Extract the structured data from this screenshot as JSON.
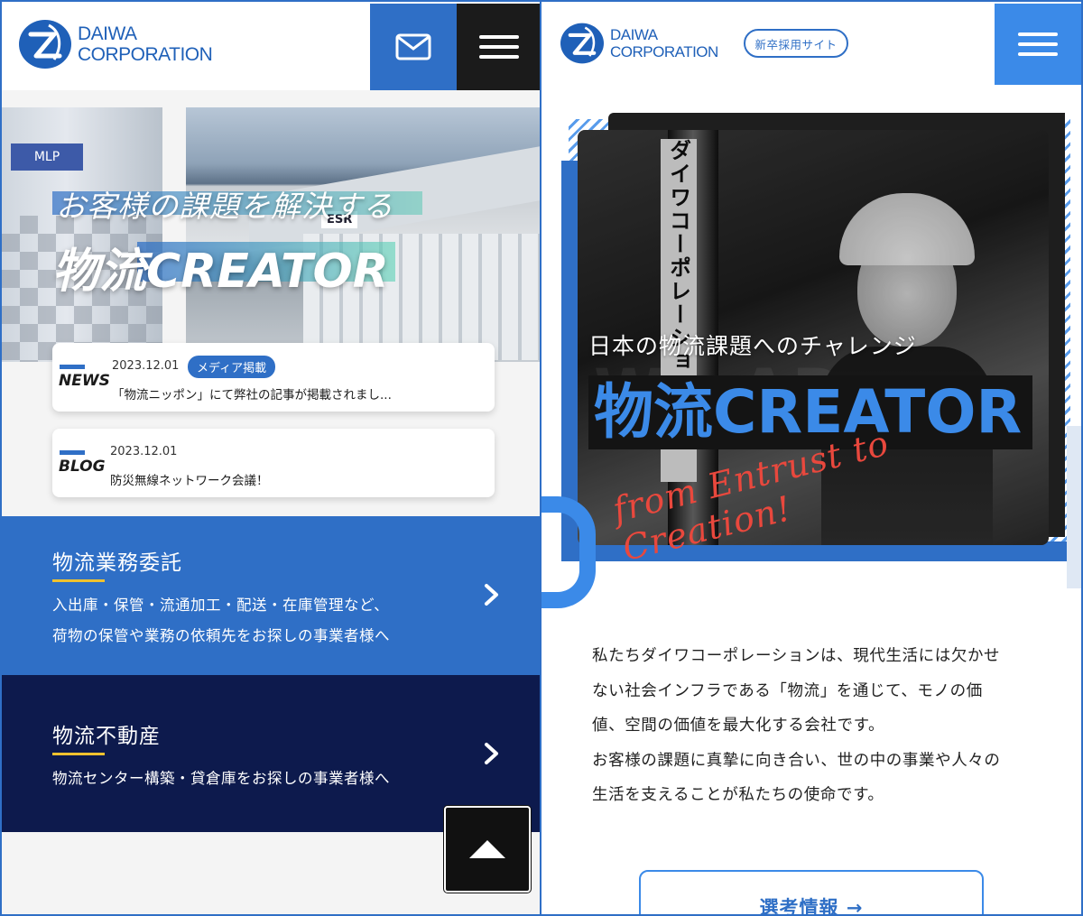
{
  "left": {
    "logo": {
      "line1": "DAIWA",
      "line2": "CORPORATION"
    },
    "header": {
      "mail_icon": "envelope-icon",
      "menu_icon": "hamburger-icon"
    },
    "hero": {
      "subtitle": "お客様の課題を解決する",
      "title": "物流CREATOR",
      "building_sign": "ESR"
    },
    "news": [
      {
        "kind": "NEWS",
        "date": "2023.12.01",
        "badge": "メディア掲載",
        "text": "「物流ニッポン」にて弊社の記事が掲載されまし..."
      },
      {
        "kind": "BLOG",
        "date": "2023.12.01",
        "text": "防災無線ネットワーク会議！"
      }
    ],
    "services": [
      {
        "title": "物流業務委託",
        "desc": [
          "入出庫・保管・流通加工・配送・在庫管理など、",
          "荷物の保管や業務の依頼先をお探しの事業者様へ"
        ]
      },
      {
        "title": "物流不動産",
        "desc": [
          "物流センター構築・貸倉庫をお探しの事業者様へ"
        ]
      }
    ],
    "top_button_icon": "triangle-up-icon"
  },
  "right": {
    "logo": {
      "line1": "DAIWA",
      "line2": "CORPORATION"
    },
    "recruit_label": "新卒採用サイト",
    "hero": {
      "sign_text": "ダイワコーポレーション",
      "subtitle": "日本の物流課題へのチャレンジ",
      "title": "物流CREATOR",
      "script": "from Entrust to Creation!"
    },
    "intro": [
      "私たちダイワコーポレーションは、現代生活には欠かせ",
      "ない社会インフラである「物流」を通じて、モノの価",
      "値、空間の価値を最大化する会社です。",
      "お客様の課題に真摯に向き合い、世の中の事業や人々の",
      "生活を支えることが私たちの使命です。"
    ],
    "select_button": "選考情報 →"
  },
  "colors": {
    "brand_blue": "#2f6fc6",
    "light_blue": "#3b8ae8",
    "navy": "#0d1a4d",
    "accent_yellow": "#f0c22e",
    "script_red": "#e9483d"
  }
}
